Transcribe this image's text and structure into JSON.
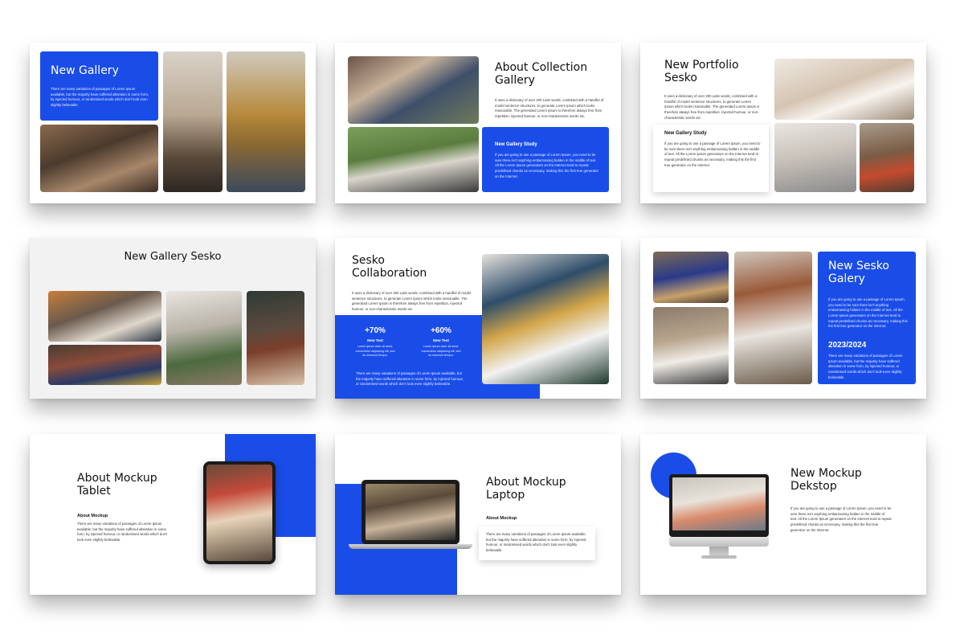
{
  "lorem": {
    "long": "There are many variations of passages of Lorem Ipsum available, but the majority have suffered alteration in some form, by injected humour, or randomised words which don't look even slightly believable.",
    "dictionary": "It uses a dictionary of over 200 Latin words, combined with a handful of model sentence structures, to generate Lorem Ipsum which looks reasonable. The generated Lorem Ipsum is therefore always free from repetition, injected humour, or non-characteristic words etc.",
    "going": "If you are going to use a passage of Lorem Ipsum, you need to be sure there isn't anything embarrassing hidden in the middle of text. All the Lorem Ipsum generators on the Internet tend to repeat predefined chunks as necessary, making this the first true generator on the Internet.",
    "short": "Lorem ipsum dolor sit amet, consectetur adipiscing elit, sed do eiusmod tempor."
  },
  "slide1": {
    "title": "New Gallery"
  },
  "slide2": {
    "title": "About Collection Gallery",
    "card_title": "New Gallery Study"
  },
  "slide3": {
    "title": "New Portfolio Sesko",
    "card_title": "New Gallery Study"
  },
  "slide4": {
    "title": "New Gallery Sesko"
  },
  "slide5": {
    "title": "Sesko Collaboration",
    "stats": [
      {
        "value": "+70%",
        "label": "New Text"
      },
      {
        "value": "+60%",
        "label": "New Text"
      }
    ]
  },
  "slide6": {
    "title": "New Sesko Galery",
    "year": "2023/2024"
  },
  "slide7": {
    "title": "About Mockup Tablet",
    "sub": "About Mockup"
  },
  "slide8": {
    "title": "About Mockup Laptop",
    "sub": "About Mockup"
  },
  "slide9": {
    "title": "New Mockup Dekstop"
  },
  "colors": {
    "accent": "#1a4de8",
    "background": "#ffffff",
    "text": "#111111"
  },
  "icons": [
    "tablet-device",
    "laptop-device",
    "desktop-monitor"
  ]
}
